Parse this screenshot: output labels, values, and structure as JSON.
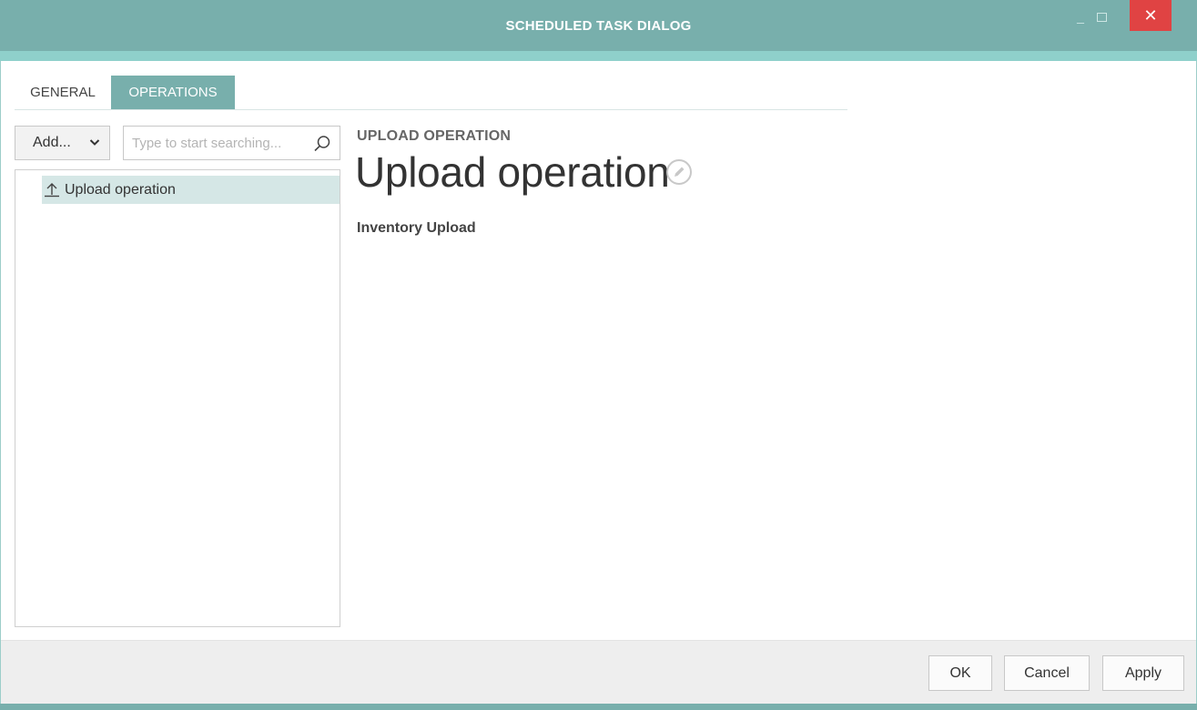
{
  "window": {
    "title": "SCHEDULED TASK DIALOG",
    "minimize_glyph": "_",
    "close_glyph": "✕"
  },
  "tabs": [
    {
      "label": "GENERAL",
      "active": false
    },
    {
      "label": "OPERATIONS",
      "active": true
    }
  ],
  "left_panel": {
    "add_button_label": "Add...",
    "search_placeholder": "Type to start searching...",
    "search_value": "",
    "tree_items": [
      {
        "label": "Upload operation",
        "icon": "upload-arrow-icon",
        "selected": true
      }
    ]
  },
  "detail": {
    "section_label": "UPLOAD OPERATION",
    "title": "Upload operation",
    "description": "Inventory Upload"
  },
  "footer": {
    "ok_label": "OK",
    "cancel_label": "Cancel",
    "apply_label": "Apply"
  },
  "colors": {
    "accent": "#78afac",
    "accent_light": "#8fd0cb",
    "selection": "#d5e7e6",
    "close_button": "#e04343"
  }
}
